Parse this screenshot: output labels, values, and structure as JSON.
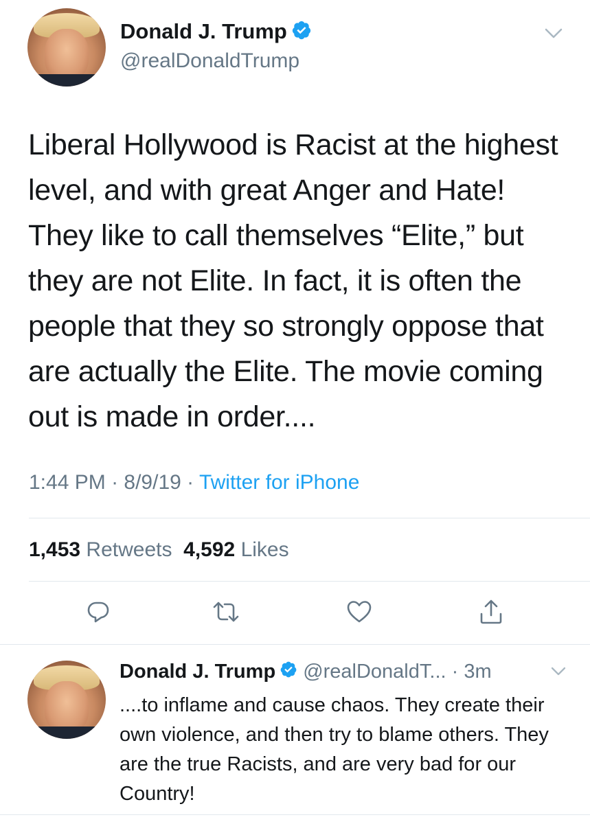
{
  "main_tweet": {
    "author_name": "Donald J. Trump",
    "handle": "@realDonaldTrump",
    "text": "Liberal Hollywood is Racist at the highest level, and with great Anger and Hate! They like to call themselves “Elite,” but they are not Elite. In fact, it is often the people that they so strongly oppose that are actually the Elite. The movie coming out is made in order....",
    "time": "1:44 PM",
    "date": "8/9/19",
    "separator": " · ",
    "source": "Twitter for iPhone",
    "retweets_count": "1,453",
    "retweets_label": "Retweets",
    "likes_count": "4,592",
    "likes_label": "Likes"
  },
  "reply_tweet": {
    "author_name": "Donald J. Trump",
    "handle": "@realDonaldT...",
    "age": "3m",
    "text": "....to inflame and cause chaos. They create their own violence, and then try to blame others. They are the true Racists, and are very bad for our Country!"
  },
  "icons": {
    "verified": "verified-badge-icon",
    "menu": "chevron-down-icon",
    "reply": "reply-icon",
    "retweet": "retweet-icon",
    "like": "heart-icon",
    "share": "share-icon"
  },
  "colors": {
    "text": "#14171a",
    "secondary": "#657786",
    "link": "#1da1f2",
    "verified": "#1da1f2",
    "divider": "#e1e8ed"
  }
}
